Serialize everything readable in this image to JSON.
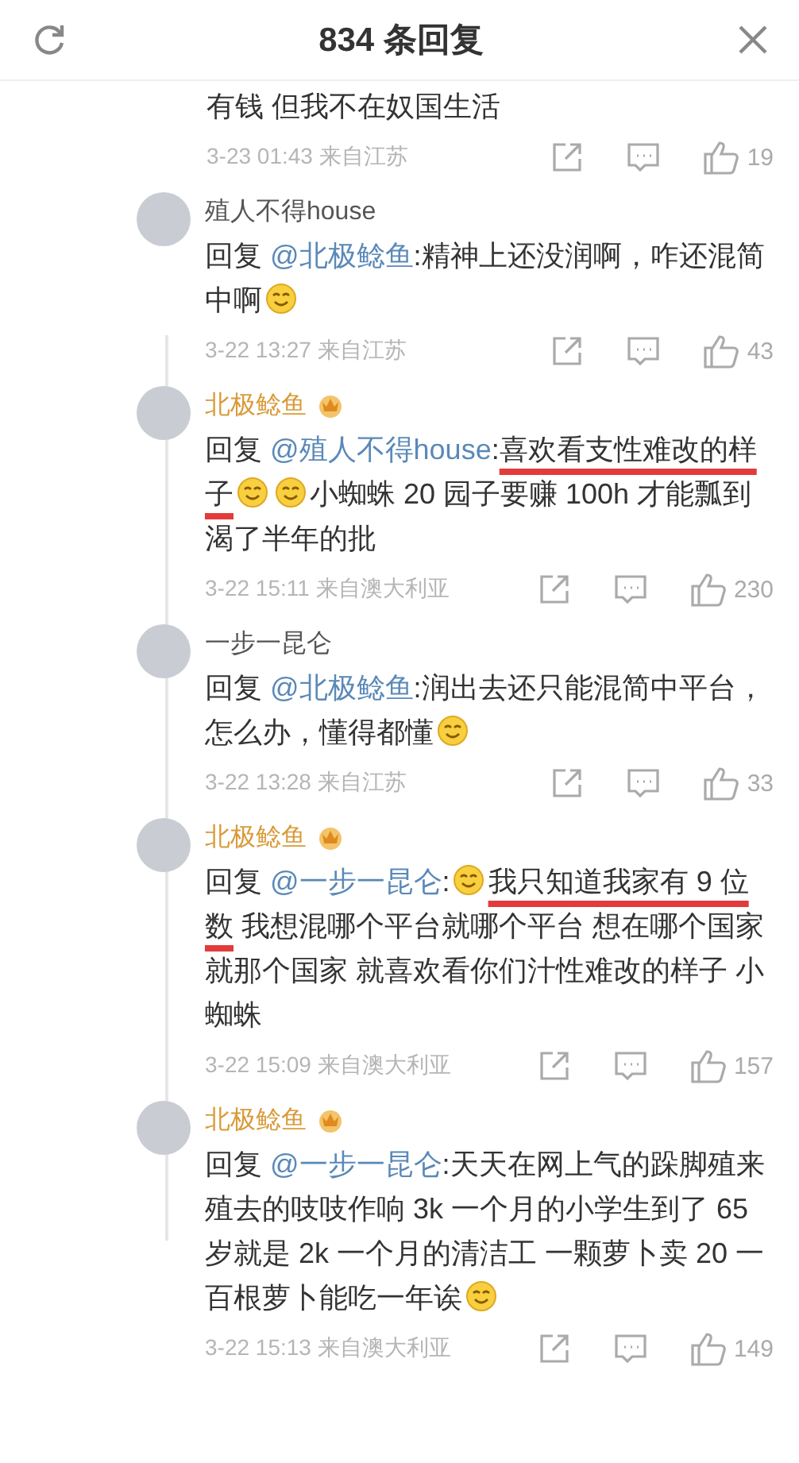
{
  "header": {
    "title": "834 条回复"
  },
  "comments": [
    {
      "partial": true,
      "segments": [
        {
          "kind": "text",
          "text": "有钱 但我不在奴国生活"
        }
      ],
      "meta": "3-23 01:43 来自江苏",
      "likes": "19"
    },
    {
      "name": "殖人不得house",
      "crown": false,
      "segments": [
        {
          "kind": "text",
          "text": "回复 "
        },
        {
          "kind": "mention",
          "text": "@北极鲶鱼"
        },
        {
          "kind": "text",
          "text": ":精神上还没润啊，咋还混简中啊"
        },
        {
          "kind": "emoji"
        }
      ],
      "meta": "3-22 13:27 来自江苏",
      "likes": "43"
    },
    {
      "name": "北极鲶鱼",
      "crown": true,
      "segments": [
        {
          "kind": "text",
          "text": "回复 "
        },
        {
          "kind": "mention",
          "text": "@殖人不得house"
        },
        {
          "kind": "text",
          "text": ":"
        },
        {
          "kind": "marked",
          "text": "喜欢看支性难改的样子"
        },
        {
          "kind": "emoji"
        },
        {
          "kind": "emoji"
        },
        {
          "kind": "text",
          "text": "小蜘蛛 20 园子要赚 100h 才能瓢到渴了半年的批"
        }
      ],
      "meta": "3-22 15:11 来自澳大利亚",
      "likes": "230"
    },
    {
      "name": "一步一昆仑",
      "crown": false,
      "segments": [
        {
          "kind": "text",
          "text": "回复 "
        },
        {
          "kind": "mention",
          "text": "@北极鲶鱼"
        },
        {
          "kind": "text",
          "text": ":润出去还只能混简中平台，怎么办，懂得都懂"
        },
        {
          "kind": "emoji"
        }
      ],
      "meta": "3-22 13:28 来自江苏",
      "likes": "33"
    },
    {
      "name": "北极鲶鱼",
      "crown": true,
      "segments": [
        {
          "kind": "text",
          "text": "回复 "
        },
        {
          "kind": "mention",
          "text": "@一步一昆仑"
        },
        {
          "kind": "text",
          "text": ":"
        },
        {
          "kind": "emoji"
        },
        {
          "kind": "marked",
          "text": "我只知道我家有 9 位数"
        },
        {
          "kind": "text",
          "text": " 我想混哪个平台就哪个平台 想在哪个国家就那个国家 就喜欢看你们汁性难改的样子 小蜘蛛"
        }
      ],
      "meta": "3-22 15:09 来自澳大利亚",
      "likes": "157"
    },
    {
      "name": "北极鲶鱼",
      "crown": true,
      "segments": [
        {
          "kind": "text",
          "text": "回复 "
        },
        {
          "kind": "mention",
          "text": "@一步一昆仑"
        },
        {
          "kind": "text",
          "text": ":天天在网上气的跺脚殖来殖去的吱吱作响 3k 一个月的小学生到了 65 岁就是 2k 一个月的清洁工 一颗萝卜卖 20 一百根萝卜能吃一年诶"
        },
        {
          "kind": "emoji"
        }
      ],
      "meta": "3-22 15:13 来自澳大利亚",
      "likes": "149"
    }
  ]
}
